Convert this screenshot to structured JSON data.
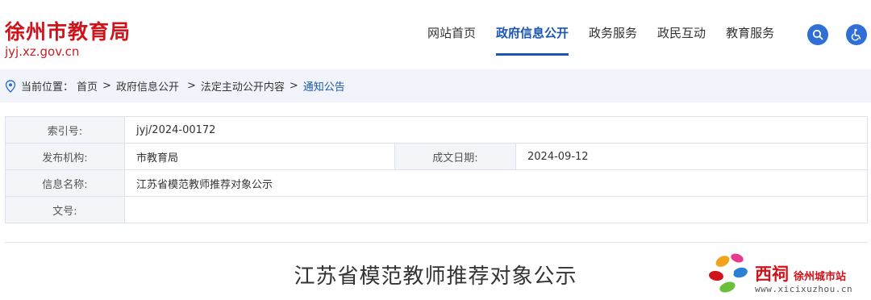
{
  "header": {
    "site_name": "徐州市教育局",
    "site_url": "jyj.xz.gov.cn",
    "nav": [
      {
        "label": "网站首页",
        "active": false
      },
      {
        "label": "政府信息公开",
        "active": true
      },
      {
        "label": "政务服务",
        "active": false
      },
      {
        "label": "政民互动",
        "active": false
      },
      {
        "label": "教育服务",
        "active": false
      }
    ],
    "search_icon": "search-icon",
    "accessibility_icon": "accessibility-icon",
    "accent_color": "#1b56b3",
    "brand_color": "#d0121b"
  },
  "breadcrumb": {
    "prefix": "当前位置：",
    "items": [
      "首页",
      "政府信息公开",
      "法定主动公开内容",
      "通知公告"
    ],
    "separator": ">"
  },
  "info": {
    "index_label": "索引号:",
    "index_value": "jyj/2024-00172",
    "publisher_label": "发布机构:",
    "publisher_value": "市教育局",
    "date_label": "成文日期:",
    "date_value": "2024-09-12",
    "name_label": "信息名称:",
    "name_value": "江苏省模范教师推荐对象公示",
    "docno_label": "文号:",
    "docno_value": ""
  },
  "article": {
    "title": "江苏省模范教师推荐对象公示"
  },
  "watermark": {
    "brand": "西祠",
    "city": "徐州城市站",
    "url": "www.xicixuzhou.cn"
  }
}
